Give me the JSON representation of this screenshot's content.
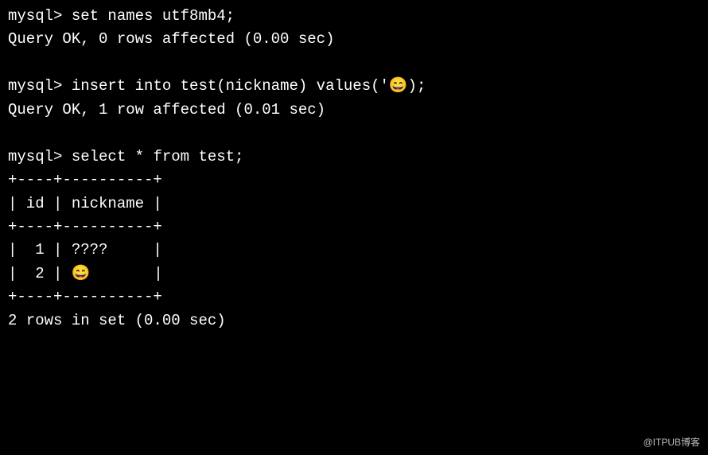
{
  "terminal": {
    "prompt": "mysql> ",
    "commands": {
      "set_names": "set names utf8mb4;",
      "set_names_result": "Query OK, 0 rows affected (0.00 sec)",
      "insert": "insert into test(nickname) values('😄);",
      "insert_result": "Query OK, 1 row affected (0.01 sec)",
      "select": "select * from test;"
    },
    "table": {
      "border_top": "+----+----------+",
      "header": "| id | nickname |",
      "border_mid": "+----+----------+",
      "row1": "|  1 | ????     |",
      "row2": "|  2 | 😄       |",
      "border_bot": "+----+----------+",
      "footer": "2 rows in set (0.00 sec)"
    }
  },
  "watermark": "@ITPUB博客"
}
